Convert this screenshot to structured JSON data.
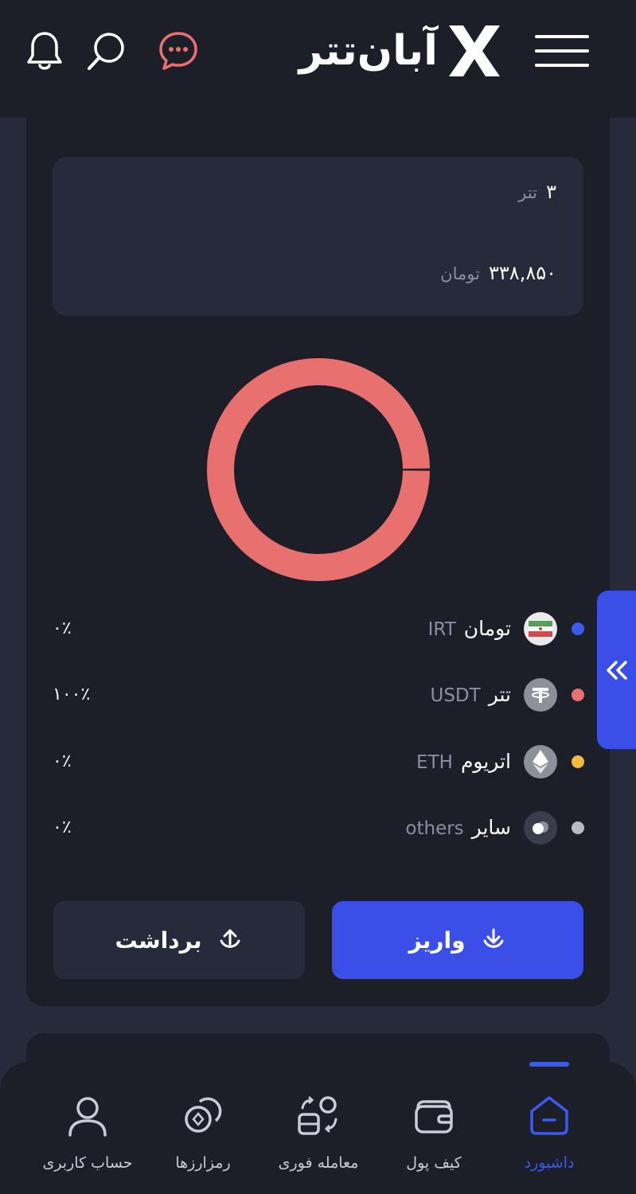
{
  "colors": {
    "background": "#262a3a",
    "card": "#1c1e28",
    "accent": "#3a4ee8",
    "tether": "#e8706e",
    "toman": "#3a5af0",
    "eth": "#f5b93b",
    "others": "#b8bac4",
    "chat": "#e8706e"
  },
  "header": {
    "logo_text": "آبان‌تتر",
    "icons": [
      "menu-icon",
      "logo-x-icon",
      "chat-icon",
      "search-icon",
      "bell-icon"
    ]
  },
  "balance": {
    "primary_value": "۳",
    "primary_unit": "تتر",
    "secondary_value": "۳۳۸,۸۵۰",
    "secondary_unit": "تومان"
  },
  "chart_data": {
    "type": "pie",
    "categories": [
      "IRT",
      "USDT",
      "ETH",
      "others"
    ],
    "values": [
      0,
      100,
      0,
      0
    ],
    "colors": [
      "#3a5af0",
      "#e8706e",
      "#f5b93b",
      "#b8bac4"
    ],
    "legend": "below"
  },
  "legend": [
    {
      "name_fa": "تومان",
      "name_en": "IRT",
      "percent": "۰٪",
      "icon": "iran-flag-icon",
      "color": "#3a5af0"
    },
    {
      "name_fa": "تتر",
      "name_en": "USDT",
      "percent": "۱۰۰٪",
      "icon": "tether-icon",
      "color": "#e8706e"
    },
    {
      "name_fa": "اتریوم",
      "name_en": "ETH",
      "percent": "۰٪",
      "icon": "ethereum-icon",
      "color": "#f5b93b"
    },
    {
      "name_fa": "سایر",
      "name_en": "others",
      "percent": "۰٪",
      "icon": "others-icon",
      "color": "#b8bac4"
    }
  ],
  "actions": {
    "deposit_label": "واریز",
    "withdraw_label": "برداشت"
  },
  "nav": [
    {
      "label": "داشبورد",
      "icon": "home-icon",
      "active": true
    },
    {
      "label": "کیف پول",
      "icon": "wallet-icon",
      "active": false
    },
    {
      "label": "معامله فوری",
      "icon": "instant-trade-icon",
      "active": false
    },
    {
      "label": "رمزارزها",
      "icon": "coins-icon",
      "active": false
    },
    {
      "label": "حساب کاربری",
      "icon": "user-icon",
      "active": false
    }
  ]
}
